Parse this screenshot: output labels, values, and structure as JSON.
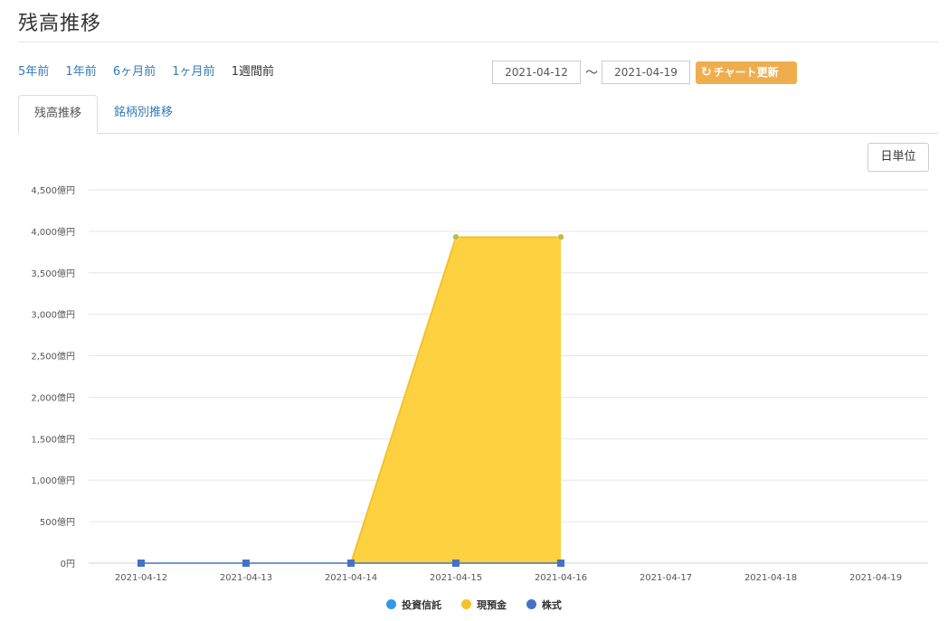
{
  "page": {
    "title": "残高推移"
  },
  "period_links": [
    {
      "label": "5年前",
      "active": false
    },
    {
      "label": "1年前",
      "active": false
    },
    {
      "label": "6ヶ月前",
      "active": false
    },
    {
      "label": "1ヶ月前",
      "active": false
    },
    {
      "label": "1週間前",
      "active": true
    }
  ],
  "date_range": {
    "from": "2021-04-12",
    "separator": "〜",
    "to": "2021-04-19",
    "update_icon": "refresh-icon",
    "update_label": "チャート更新"
  },
  "tabs": [
    {
      "label": "残高推移",
      "active": true
    },
    {
      "label": "銘柄別推移",
      "active": false
    }
  ],
  "unit_button": {
    "label": "日単位"
  },
  "colors": {
    "link": "#337ab7",
    "update_button": "#f0ad4e",
    "cash_area": "#fdd13f",
    "cash_line": "#f6c12a",
    "stock": "#4572c4",
    "fund": "#3498e8",
    "point_fill": "#b7c04a"
  },
  "chart_data": {
    "type": "area",
    "x": [
      "2021-04-12",
      "2021-04-13",
      "2021-04-14",
      "2021-04-15",
      "2021-04-16",
      "2021-04-17",
      "2021-04-18",
      "2021-04-19"
    ],
    "yticks": [
      "0円",
      "500億円",
      "1,000億円",
      "1,500億円",
      "2,000億円",
      "2,500億円",
      "3,000億円",
      "3,500億円",
      "4,000億円",
      "4,500億円"
    ],
    "ylim": [
      0,
      4500
    ],
    "grid": true,
    "legend_position": "bottom",
    "series": [
      {
        "name": "投資信託",
        "color": "#3498e8",
        "values": [
          0,
          0,
          0,
          0,
          0,
          null,
          null,
          null
        ],
        "render": "line"
      },
      {
        "name": "現預金",
        "color": "#fdd13f",
        "values": [
          null,
          null,
          0,
          3930,
          3930,
          null,
          null,
          null
        ],
        "render": "area"
      },
      {
        "name": "株式",
        "color": "#4572c4",
        "values": [
          0,
          0,
          0,
          0,
          0,
          null,
          null,
          null
        ],
        "render": "line-square"
      }
    ]
  }
}
